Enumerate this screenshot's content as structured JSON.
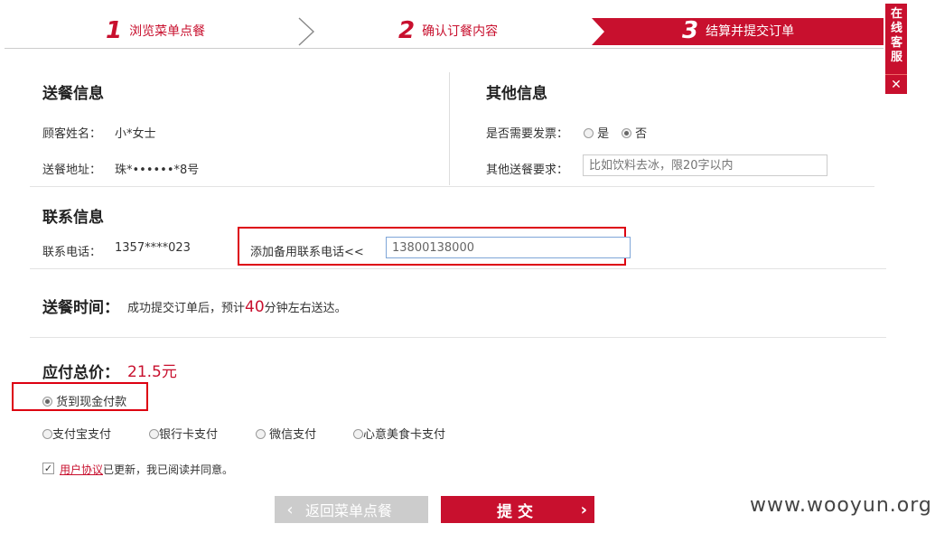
{
  "steps": [
    {
      "num": "1",
      "label": "浏览菜单点餐"
    },
    {
      "num": "2",
      "label": "确认订餐内容"
    },
    {
      "num": "3",
      "label": "结算并提交订单"
    }
  ],
  "service": {
    "label": "在线客服",
    "close": "✕"
  },
  "delivery": {
    "title": "送餐信息",
    "name_label": "顾客姓名：",
    "name_value": "小*女士",
    "address_label": "送餐地址：",
    "address_value": "珠*••••••*8号"
  },
  "other": {
    "title": "其他信息",
    "invoice_label": "是否需要发票：",
    "invoice_yes": "是",
    "invoice_no": "否",
    "note_label": "其他送餐要求：",
    "note_placeholder": "比如饮料去冰，限20字以内"
  },
  "contact": {
    "title": "联系信息",
    "phone_label": "联系电话：",
    "phone_value": "1357****023",
    "backup_label": "添加备用联系电话<<",
    "backup_value": "13800138000"
  },
  "time": {
    "title": "送餐时间：",
    "text_before": "成功提交订单后，预计",
    "minutes": "40",
    "text_after": "分钟左右送达。"
  },
  "total": {
    "title": "应付总价：",
    "amount": "21.5元"
  },
  "payment": {
    "cash": "货到现金付款",
    "alipay": "支付宝支付",
    "bank": "银行卡支付",
    "wechat": "微信支付",
    "card": "心意美食卡支付"
  },
  "agreement": {
    "link": "用户协议",
    "text": "已更新，我已阅读并同意。"
  },
  "buttons": {
    "back": "返回菜单点餐",
    "submit": "提交"
  },
  "watermark": "www.wooyun.org",
  "colors": {
    "accent": "#c8102e",
    "highlight_box": "#dd0011"
  }
}
